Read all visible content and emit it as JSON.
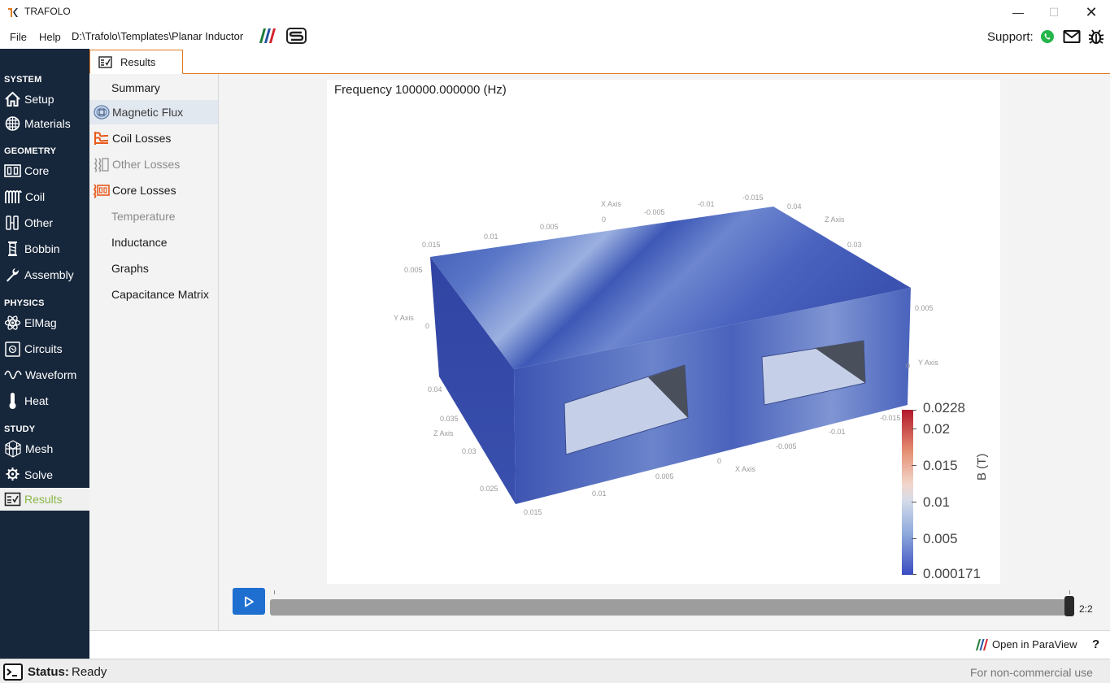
{
  "app": {
    "title": "TRAFOLO",
    "file_path": "D:\\Trafolo\\Templates\\Planar Inductor"
  },
  "menu": {
    "file": "File",
    "help": "Help"
  },
  "support": {
    "label": "Support:"
  },
  "sidebar": {
    "sections": [
      {
        "title": "SYSTEM",
        "items": [
          {
            "label": "Setup",
            "icon": "home-icon"
          },
          {
            "label": "Materials",
            "icon": "materials-icon"
          }
        ]
      },
      {
        "title": "GEOMETRY",
        "items": [
          {
            "label": "Core",
            "icon": "core-icon"
          },
          {
            "label": "Coil",
            "icon": "coil-icon"
          },
          {
            "label": "Other",
            "icon": "other-icon"
          },
          {
            "label": "Bobbin",
            "icon": "bobbin-icon"
          },
          {
            "label": "Assembly",
            "icon": "wrench-icon"
          }
        ]
      },
      {
        "title": "PHYSICS",
        "items": [
          {
            "label": "ElMag",
            "icon": "atom-icon"
          },
          {
            "label": "Circuits",
            "icon": "circuit-icon"
          },
          {
            "label": "Waveform",
            "icon": "wave-icon"
          },
          {
            "label": "Heat",
            "icon": "thermometer-icon"
          }
        ]
      },
      {
        "title": "STUDY",
        "items": [
          {
            "label": "Mesh",
            "icon": "mesh-icon"
          },
          {
            "label": "Solve",
            "icon": "solve-icon"
          },
          {
            "label": "Results",
            "icon": "results-icon",
            "active": true
          }
        ]
      }
    ]
  },
  "tabs": [
    {
      "label": "Results"
    }
  ],
  "results_nav": [
    {
      "label": "Summary",
      "state": "normal"
    },
    {
      "label": "Magnetic Flux",
      "state": "selected",
      "icon": "magnetic-flux-icon"
    },
    {
      "label": "Coil Losses",
      "state": "normal",
      "icon": "coil-losses-icon"
    },
    {
      "label": "Other Losses",
      "state": "disabled",
      "icon": "other-losses-icon"
    },
    {
      "label": "Core Losses",
      "state": "normal",
      "icon": "core-losses-icon"
    },
    {
      "label": "Temperature",
      "state": "disabled"
    },
    {
      "label": "Inductance",
      "state": "normal"
    },
    {
      "label": "Graphs",
      "state": "normal"
    },
    {
      "label": "Capacitance Matrix",
      "state": "normal"
    }
  ],
  "viewport": {
    "frequency_text": "Frequency 100000.000000 (Hz)",
    "axis_labels": {
      "x_axis": "X Axis",
      "y_axis": "Y Axis",
      "z_axis": "Z Axis",
      "top_x_ticks": [
        "0.015",
        "0.01",
        "0.005",
        "0",
        "-0.005",
        "-0.01",
        "-0.015"
      ],
      "top_z_ticks": [
        "0.04",
        "0.03"
      ],
      "left_y_ticks": [
        "0.005",
        "0"
      ],
      "right_y_ticks": [
        "0.005",
        "0"
      ],
      "left_z_ticks": [
        "0.04",
        "0.035",
        "0.03",
        "0.025"
      ],
      "bottom_x_ticks": [
        "0.015",
        "0.01",
        "0.005",
        "0",
        "-0.005",
        "-0.01",
        "-0.015"
      ]
    },
    "colorbar": {
      "title": "B (T)",
      "labels": [
        "0.0228",
        "0.02",
        "0.015",
        "0.01",
        "0.005",
        "0.000171"
      ],
      "colors": {
        "max": "#b2182b",
        "mid": "#f2d6cb",
        "min": "#3b4cc0"
      }
    }
  },
  "playback": {
    "frame_counter": "2:2",
    "position": 1.0
  },
  "bottom": {
    "open_paraview": "Open in ParaView",
    "help": "?"
  },
  "status": {
    "label": "Status:",
    "value": "Ready",
    "license": "For non-commercial use"
  }
}
